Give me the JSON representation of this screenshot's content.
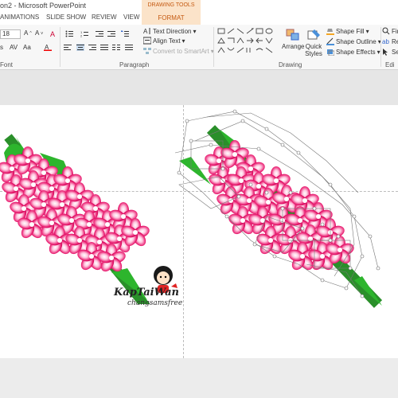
{
  "titlebar": {
    "title": "on2 - Microsoft PowerPoint",
    "context_tab": "DRAWING TOOLS"
  },
  "tabs": [
    "ANIMATIONS",
    "SLIDE SHOW",
    "REVIEW",
    "VIEW",
    "FORMAT"
  ],
  "ribbon": {
    "font_size": "18",
    "font_group_label": "Font",
    "paragraph_group_label": "Paragraph",
    "drawing_group_label": "Drawing",
    "editing_group_label": "Edi",
    "text_direction": "Text Direction",
    "align_text": "Align Text",
    "convert_smartart": "Convert to SmartArt",
    "arrange": "Arrange",
    "quick_styles": "Quick Styles",
    "shape_fill": "Shape Fill",
    "shape_outline": "Shape Outline",
    "shape_effects": "Shape Effects",
    "find": "Fin",
    "replace": "Rep",
    "select": "Sel"
  },
  "watermark": {
    "line1": "KapTaiWan",
    "line2": "changsamsfree"
  },
  "colors": {
    "accent_orange": "#c55a11",
    "flower_pink": "#e8186d",
    "leaf_green": "#2db52d"
  }
}
